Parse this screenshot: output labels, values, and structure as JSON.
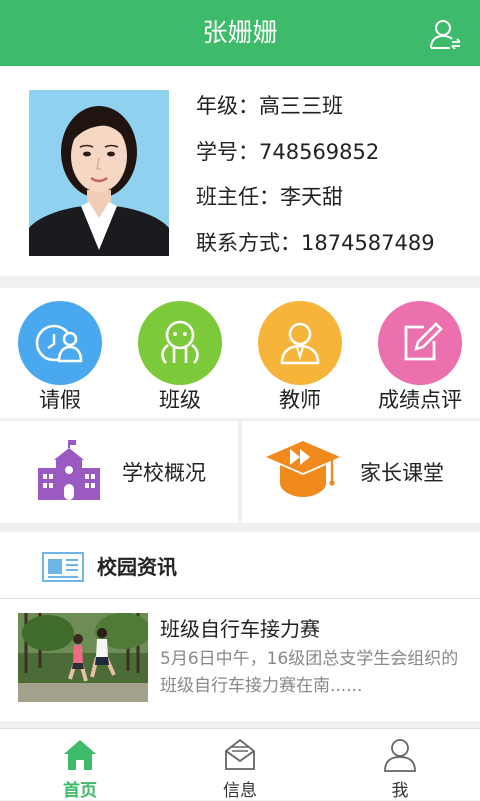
{
  "header": {
    "title": "张姗姗"
  },
  "profile": {
    "grade_label": "年级：",
    "grade_value": "高三三班",
    "student_id_label": "学号：",
    "student_id_value": "748569852",
    "head_teacher_label": "班主任：",
    "head_teacher_value": "李天甜",
    "contact_label": "联系方式：",
    "contact_value": "1874587489"
  },
  "menu": [
    {
      "label": "请假",
      "icon": "calendar-person-icon",
      "color": "#4aa8ee"
    },
    {
      "label": "班级",
      "icon": "class-group-icon",
      "color": "#7cc93a"
    },
    {
      "label": "教师",
      "icon": "teacher-icon",
      "color": "#f6b43a"
    },
    {
      "label": "成绩点评",
      "icon": "edit-review-icon",
      "color": "#ec6fae"
    }
  ],
  "links": [
    {
      "label": "学校概况",
      "icon": "school-building-icon"
    },
    {
      "label": "家长课堂",
      "icon": "parent-class-icon"
    }
  ],
  "news": {
    "title": "校园资讯",
    "items": [
      {
        "title": "班级自行车接力赛",
        "summary": "5月6日中午，16级团总支学生会组织的班级自行车接力赛在南......"
      }
    ]
  },
  "tabs": [
    {
      "label": "首页",
      "icon": "home-icon",
      "active": true
    },
    {
      "label": "信息",
      "icon": "message-icon",
      "active": false
    },
    {
      "label": "我",
      "icon": "profile-icon",
      "active": false
    }
  ],
  "colors": {
    "brand": "#3dbb6a",
    "school_icon": "#9b59c2",
    "parent_class_icon": "#f08a1c"
  }
}
